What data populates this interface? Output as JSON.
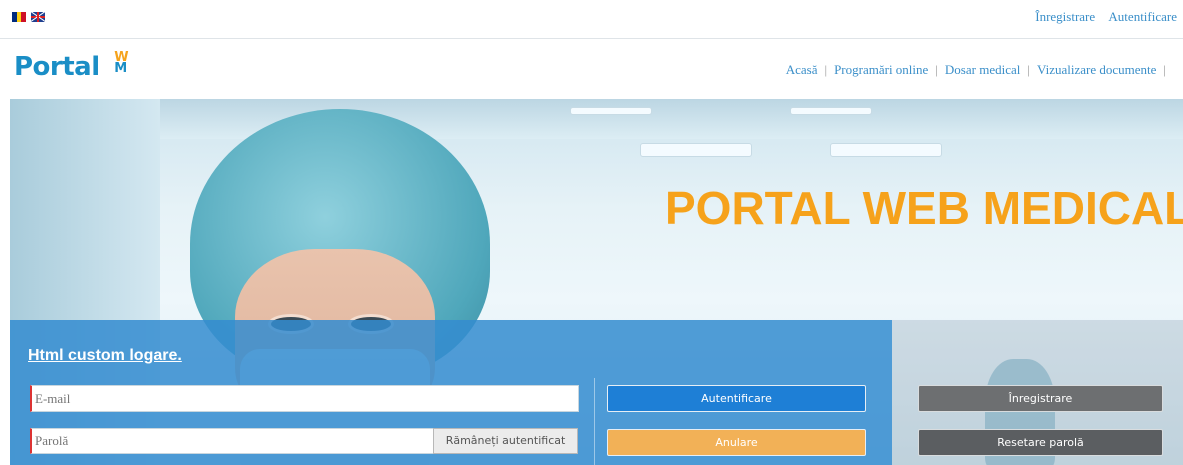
{
  "topbar": {
    "flags": [
      {
        "icon": "flag-romania-icon",
        "colors": [
          "#002b7f",
          "#fcd116",
          "#ce1126"
        ]
      },
      {
        "icon": "flag-uk-icon",
        "colors": [
          "#1f3f8f",
          "#ffffff",
          "#dd2222"
        ]
      }
    ],
    "links": {
      "register": "Înregistrare",
      "login": "Autentificare"
    }
  },
  "logo": {
    "text": "Portal",
    "badge_top": "W",
    "badge_bottom": "M"
  },
  "nav": {
    "items": [
      "Acasă",
      "Programări online",
      "Dosar medical",
      "Vizualizare documente"
    ],
    "separator": "|"
  },
  "hero": {
    "title": "PORTAL WEB MEDICAL"
  },
  "login": {
    "title": "Html custom logare.",
    "email": {
      "value": "",
      "placeholder": "E-mail"
    },
    "password": {
      "value": "",
      "placeholder": "Parolă"
    },
    "remember_label": "Rămâneți autentificat",
    "authenticate_label": "Autentificare",
    "cancel_label": "Anulare",
    "register_label": "Înregistrare",
    "reset_label": "Resetare parolă"
  },
  "colors": {
    "accent": "#1a8ec6",
    "hero_title": "#f6a21b",
    "panel": "#348cd0",
    "auth_button": "#1e7fd6",
    "cancel_button": "#f2b157",
    "gray_button": "#6d6f71"
  }
}
